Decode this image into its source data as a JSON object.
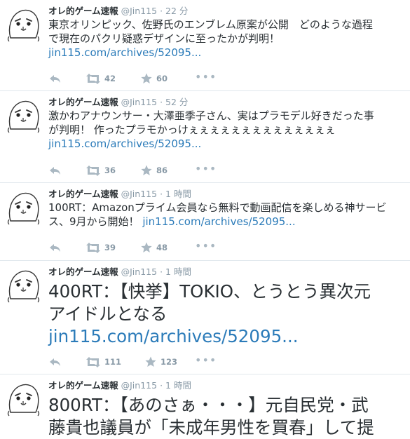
{
  "tweets": [
    {
      "name": "オレ的ゲーム速報",
      "handle": "@Jin115",
      "dot": "·",
      "time": "22 分",
      "text_lines": [
        "東京オリンピック、佐野氏のエンブレム原案が公開　どのような過程",
        "で現在のパクリ疑惑デザインに至ったかが判明！"
      ],
      "link": "jin115.com/archives/52095...",
      "retweets": "42",
      "favorites": "60",
      "more": "•••"
    },
    {
      "name": "オレ的ゲーム速報",
      "handle": "@Jin115",
      "dot": "·",
      "time": "52 分",
      "text_lines": [
        "激かわアナウンサー・大澤亜季子さん、実はプラモデル好きだった事",
        "が判明！ 作ったプラモかっけぇぇぇぇぇぇぇぇぇぇぇぇぇぇ"
      ],
      "link": "jin115.com/archives/52095...",
      "retweets": "36",
      "favorites": "86",
      "more": "•••"
    },
    {
      "name": "オレ的ゲーム速報",
      "handle": "@Jin115",
      "dot": "·",
      "time": "1 時間",
      "text_lines": [
        "100RT：Amazonプライム会員なら無料で動画配信を楽しめる神サービ",
        "ス、9月から開始！ "
      ],
      "link": "jin115.com/archives/52095...",
      "retweets": "39",
      "favorites": "48",
      "more": "•••"
    },
    {
      "name": "オレ的ゲーム速報",
      "handle": "@Jin115",
      "dot": "·",
      "time": "1 時間",
      "text_lines": [
        "400RT：【快挙】TOKIO、とうとう異次元",
        "アイドルとなる"
      ],
      "link": "jin115.com/archives/52095...",
      "retweets": "111",
      "favorites": "123",
      "more": "•••"
    },
    {
      "name": "オレ的ゲーム速報",
      "handle": "@Jin115",
      "dot": "·",
      "time": "1 時間",
      "text_lines": [
        "800RT：【あのさぁ・・・】元自民党・武",
        "藤貴也議員が「未成年男性を買春」して提"
      ]
    }
  ],
  "icons": {
    "reply": "reply-arrow-icon",
    "retweet": "retweet-icon",
    "favorite": "star-icon",
    "more": "more-dots-icon",
    "avatar": "face-avatar-icon"
  },
  "colors": {
    "name": "#292f33",
    "meta": "#8899a6",
    "link": "#2b7bb9",
    "action": "#aab8c2",
    "divider": "#e1e8ed"
  }
}
